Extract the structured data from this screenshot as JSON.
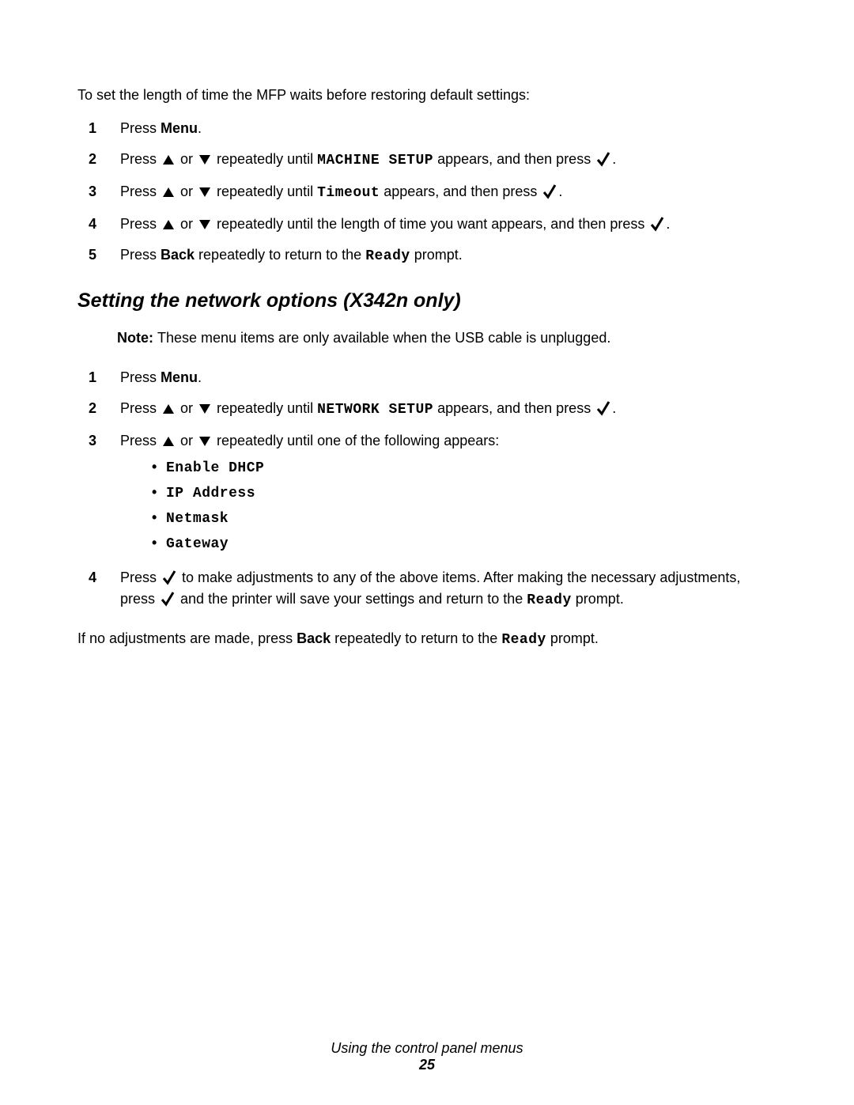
{
  "intro": "To set the length of time the MFP waits before restoring default settings:",
  "listA": {
    "s1": {
      "num": "1",
      "press": "Press ",
      "menu": "Menu",
      "p": "."
    },
    "s2": {
      "num": "2",
      "a": "Press ",
      "b": " or ",
      "c": " repeatedly until ",
      "mono": "MACHINE SETUP",
      "d": " appears, and then press ",
      "e": "."
    },
    "s3": {
      "num": "3",
      "a": "Press ",
      "b": " or ",
      "c": " repeatedly until ",
      "mono": "Timeout",
      "d": " appears, and then press ",
      "e": "."
    },
    "s4": {
      "num": "4",
      "a": "Press ",
      "b": " or ",
      "c": " repeatedly until the length of time you want appears, and then press ",
      "e": "."
    },
    "s5": {
      "num": "5",
      "a": "Press ",
      "back": "Back",
      "b": " repeatedly to return to the ",
      "mono": "Ready",
      "c": " prompt."
    }
  },
  "heading": "Setting the network options (X342n only)",
  "note": {
    "label": "Note: ",
    "text": "These menu items are only available when the USB cable is unplugged."
  },
  "listB": {
    "s1": {
      "num": "1",
      "press": "Press ",
      "menu": "Menu",
      "p": "."
    },
    "s2": {
      "num": "2",
      "a": "Press ",
      "b": " or ",
      "c": " repeatedly until ",
      "mono": "NETWORK SETUP",
      "d": " appears, and then press ",
      "e": "."
    },
    "s3": {
      "num": "3",
      "a": "Press ",
      "b": " or ",
      "c": " repeatedly until one of the following appears:"
    },
    "bullets": {
      "b1": "Enable DHCP",
      "b2": "IP Address",
      "b3": "Netmask",
      "b4": "Gateway"
    },
    "s4": {
      "num": "4",
      "a": "Press ",
      "b": " to make adjustments to any of the above items. After making the necessary adjustments, press ",
      "c": " and the printer will save your settings and return to the ",
      "mono": "Ready",
      "d": " prompt."
    }
  },
  "closing": {
    "a": "If no adjustments are made, press ",
    "back": "Back",
    "b": " repeatedly to return to the ",
    "mono": "Ready",
    "c": " prompt."
  },
  "footer": {
    "title": "Using the control panel menus",
    "page": "25"
  }
}
